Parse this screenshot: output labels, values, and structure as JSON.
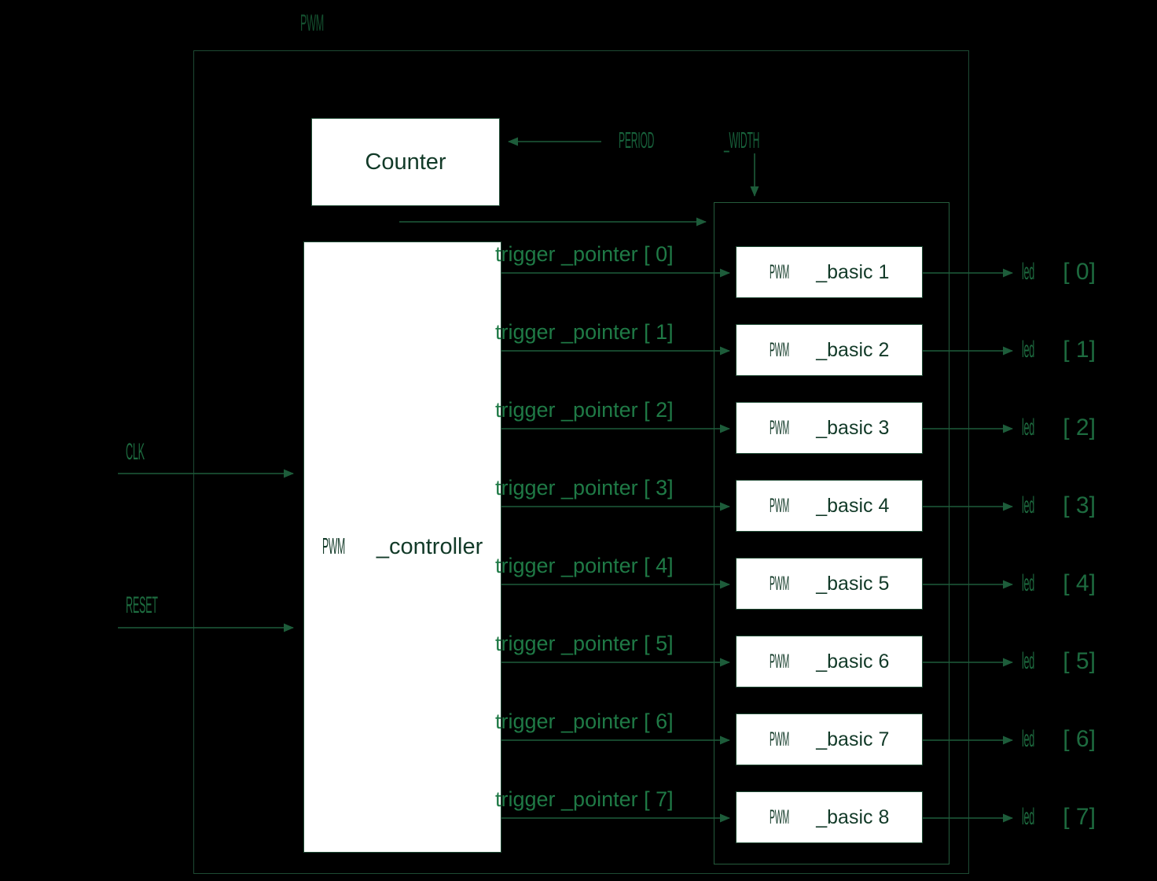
{
  "diagram": {
    "title": "PWM",
    "background_color": "#000000",
    "line_color": "#1d4a33",
    "text_color": "#1d6b3f",
    "box_fill": "#ffffff",
    "box_text_color": "#123a28"
  },
  "inputs": [
    {
      "name": "clk-input",
      "label": "CLK",
      "acronym": "CLK",
      "tail": ""
    },
    {
      "name": "reset-input",
      "label": "RESET",
      "acronym": "RESET",
      "tail": ""
    }
  ],
  "parameters": {
    "period_label": "PERIOD",
    "width_label": "_WIDTH",
    "combined_label": "PERIOD _WIDTH"
  },
  "blocks": {
    "counter": {
      "label": "Counter"
    },
    "controller": {
      "acronym": "PWM",
      "tail": " _controller",
      "label": "PWM _controller"
    },
    "basics": [
      {
        "acronym": "PWM",
        "tail": " _basic  1",
        "label": "PWM _basic 1"
      },
      {
        "acronym": "PWM",
        "tail": " _basic  2",
        "label": "PWM _basic 2"
      },
      {
        "acronym": "PWM",
        "tail": " _basic  3",
        "label": "PWM _basic 3"
      },
      {
        "acronym": "PWM",
        "tail": " _basic  4",
        "label": "PWM _basic 4"
      },
      {
        "acronym": "PWM",
        "tail": " _basic  5",
        "label": "PWM _basic 5"
      },
      {
        "acronym": "PWM",
        "tail": " _basic  6",
        "label": "PWM _basic 6"
      },
      {
        "acronym": "PWM",
        "tail": " _basic  7",
        "label": "PWM _basic 7"
      },
      {
        "acronym": "PWM",
        "tail": " _basic  8",
        "label": "PWM _basic 8"
      }
    ]
  },
  "signals": {
    "trigger_pointers": [
      "trigger  _pointer  [ 0]",
      "trigger  _pointer  [ 1]",
      "trigger  _pointer  [ 2]",
      "trigger  _pointer  [ 3]",
      "trigger  _pointer  [ 4]",
      "trigger  _pointer  [ 5]",
      "trigger  _pointer  [ 6]",
      "trigger  _pointer  [ 7]"
    ]
  },
  "outputs": [
    {
      "acronym": "led",
      "index": "[ 0]",
      "label": "led [0]"
    },
    {
      "acronym": "led",
      "index": "[ 1]",
      "label": "led [1]"
    },
    {
      "acronym": "led",
      "index": "[ 2]",
      "label": "led [2]"
    },
    {
      "acronym": "led",
      "index": "[ 3]",
      "label": "led [3]"
    },
    {
      "acronym": "led",
      "index": "[ 4]",
      "label": "led [4]"
    },
    {
      "acronym": "led",
      "index": "[ 5]",
      "label": "led [5]"
    },
    {
      "acronym": "led",
      "index": "[ 6]",
      "label": "led [6]"
    },
    {
      "acronym": "led",
      "index": "[ 7]",
      "label": "led [7]"
    }
  ]
}
